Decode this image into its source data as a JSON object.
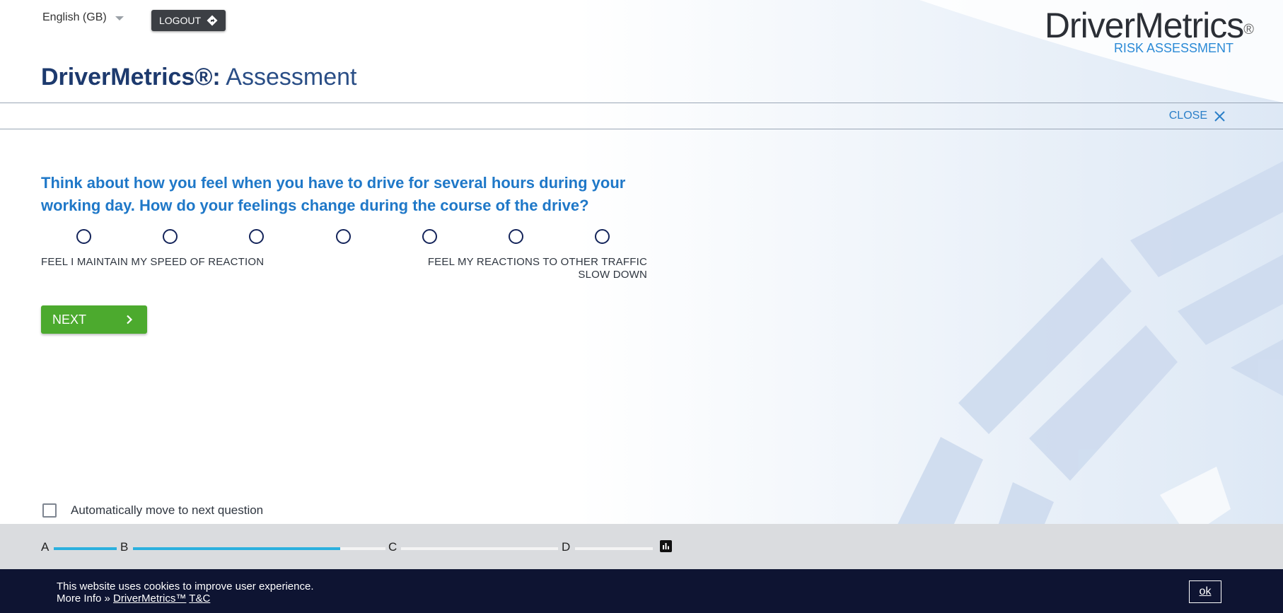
{
  "header": {
    "language": "English (GB)",
    "logout_label": "LOGOUT",
    "brand_name": "DriverMetrics",
    "brand_reg": "®",
    "brand_subtitle": "RISK ASSESSMENT",
    "title_strong": "DriverMetrics®:",
    "title_light": " Assessment",
    "close_label": "CLOSE"
  },
  "question": {
    "text": "Think about how you feel when you have to drive for several hours during your working day. How do your feelings change during the course of the drive?",
    "scale_points": 7,
    "selected": null,
    "anchor_left": "FEEL I MAINTAIN MY SPEED OF REACTION",
    "anchor_right": "FEEL MY REACTIONS TO OTHER TRAFFIC SLOW DOWN"
  },
  "next_label": "NEXT",
  "auto_move": {
    "label": "Automatically move to next question",
    "checked": false
  },
  "progress": {
    "sections": [
      {
        "label": "A",
        "fraction_complete": 1.0
      },
      {
        "label": "B",
        "fraction_complete": 0.82
      },
      {
        "label": "C",
        "fraction_complete": 0.0
      },
      {
        "label": "D",
        "fraction_complete": 0.0
      }
    ],
    "results_icon": "bar-chart-icon"
  },
  "cookie_banner": {
    "line1": "This website uses cookies to improve user experience.",
    "more_info": "More Info »",
    "link_drivermetrics": "DriverMetrics™",
    "link_tc": "T&C",
    "ok_label": "ok"
  },
  "colors": {
    "accent_blue": "#1f78c8",
    "title_navy": "#1d3a6e",
    "next_green": "#4caa2e",
    "progress_fill": "#2bb0de",
    "banner_bg": "#0e1432"
  }
}
